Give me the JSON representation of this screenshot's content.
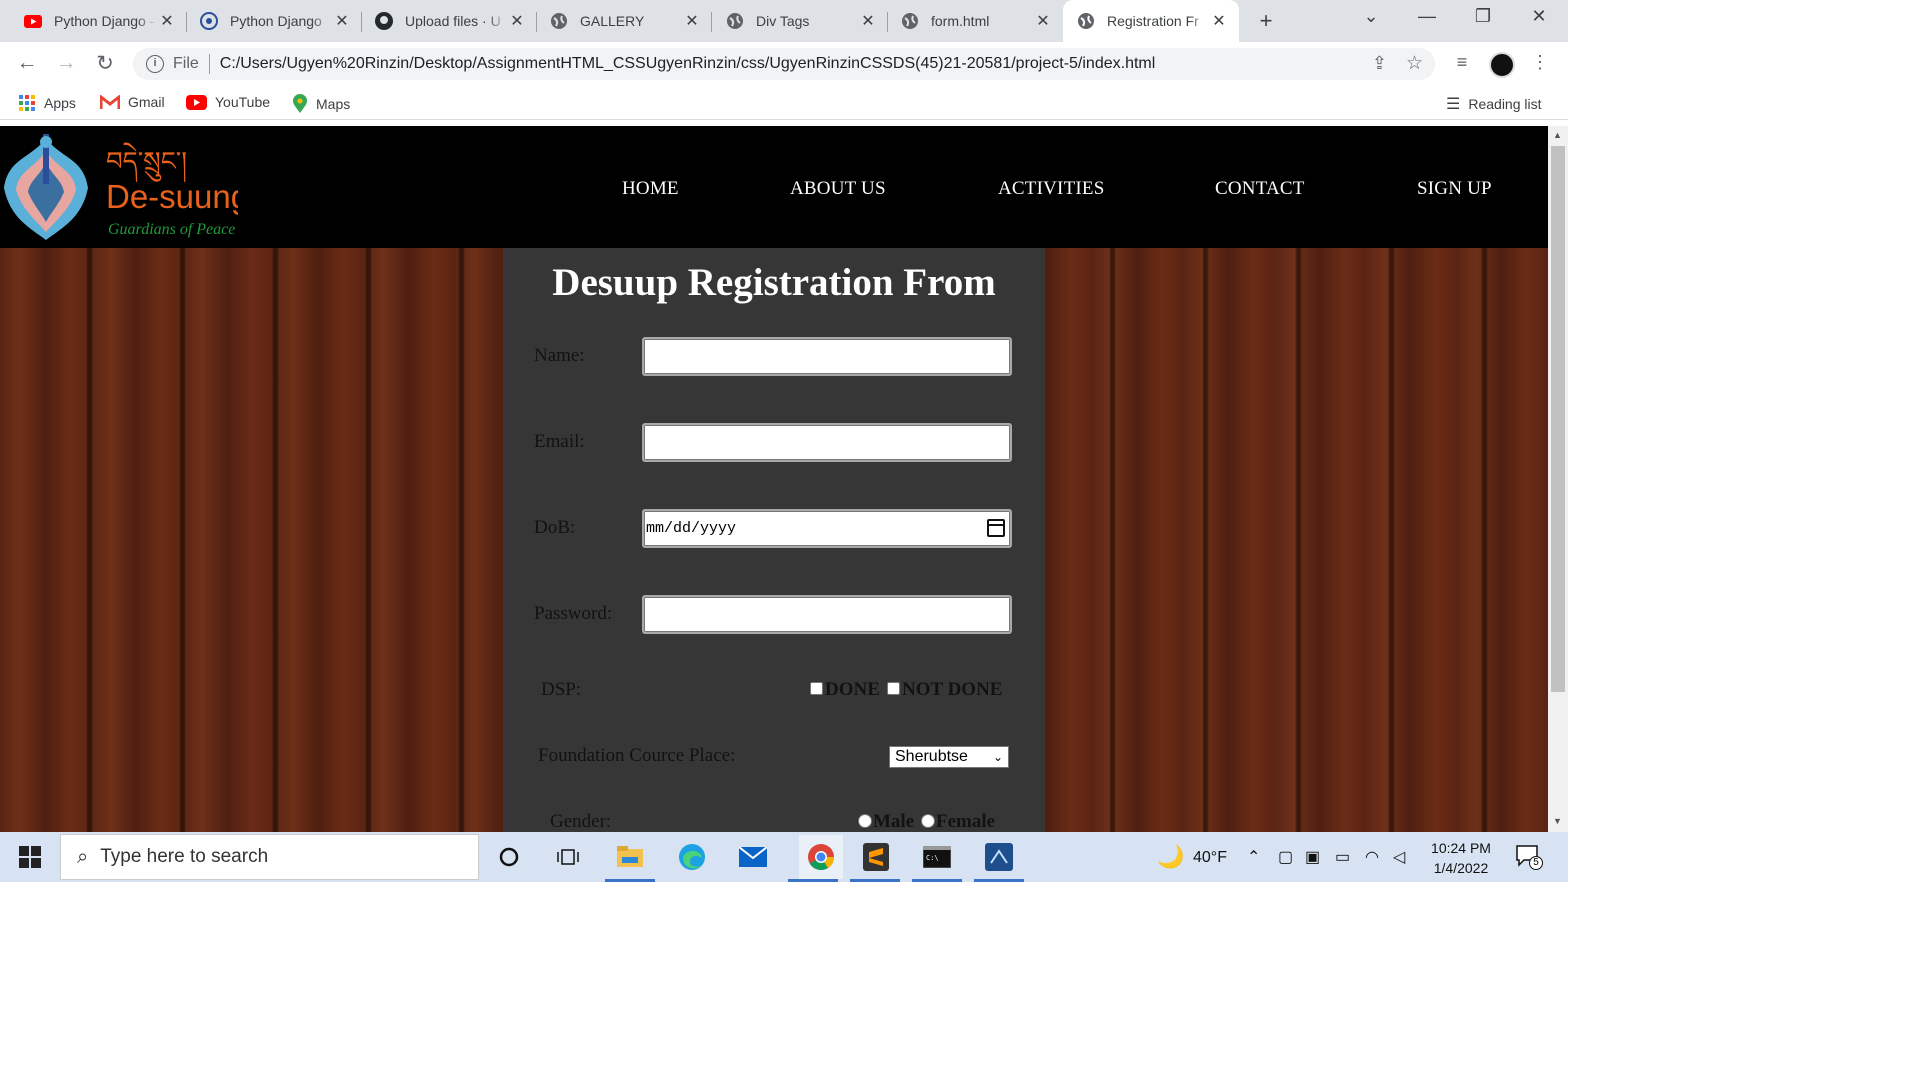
{
  "browser": {
    "tabs": [
      {
        "title": "Python Django - ",
        "icon": "youtube-icon"
      },
      {
        "title": "Python Django",
        "icon": "web-icon"
      },
      {
        "title": "Upload files · U",
        "icon": "github-icon"
      },
      {
        "title": "GALLERY",
        "icon": "globe-icon"
      },
      {
        "title": "Div Tags",
        "icon": "globe-icon"
      },
      {
        "title": "form.html",
        "icon": "globe-icon"
      },
      {
        "title": "Registration Fr",
        "icon": "globe-icon",
        "active": true
      }
    ],
    "close_glyph": "✕",
    "new_tab_glyph": "+",
    "url_scheme_label": "File",
    "url": "C:/Users/Ugyen%20Rinzin/Desktop/AssignmentHTML_CSSUgyenRinzin/css/UgyenRinzinCSSDS(45)21-20581/project-5/index.html",
    "bookmarks": [
      {
        "label": "Apps",
        "icon": "apps-grid-icon"
      },
      {
        "label": "Gmail",
        "icon": "gmail-icon"
      },
      {
        "label": "YouTube",
        "icon": "youtube-icon"
      },
      {
        "label": "Maps",
        "icon": "maps-pin-icon"
      }
    ],
    "reading_list": "Reading list"
  },
  "site": {
    "logo": {
      "name": "De-suung",
      "tagline": "Guardians of Peace",
      "script": "བདེ་སྲུང་།"
    },
    "nav": [
      "HOME",
      "ABOUT US",
      "ACTIVITIES",
      "CONTACT",
      "SIGN UP"
    ]
  },
  "form": {
    "title": "Desuup Registration From",
    "name_label": "Name:",
    "email_label": "Email:",
    "dob_label": "DoB:",
    "dob_placeholder": "mm/dd/yyyy",
    "password_label": "Password:",
    "dsp_label": "DSP:",
    "dsp_options": [
      "DONE",
      "NOT DONE"
    ],
    "foundation_label": "Foundation Cource Place:",
    "foundation_selected": "Sherubtse",
    "gender_label": "Gender:",
    "gender_options": [
      "Male",
      "Female"
    ]
  },
  "taskbar": {
    "search_placeholder": "Type here to search",
    "weather": "40°F",
    "time": "10:24 PM",
    "date": "1/4/2022",
    "notification_count": "5"
  },
  "colors": {
    "header": "#000000",
    "form_panel": "#363636",
    "wood": "#5a2514",
    "logo_orange": "#e8621c",
    "logo_green": "#1e9a3a"
  }
}
